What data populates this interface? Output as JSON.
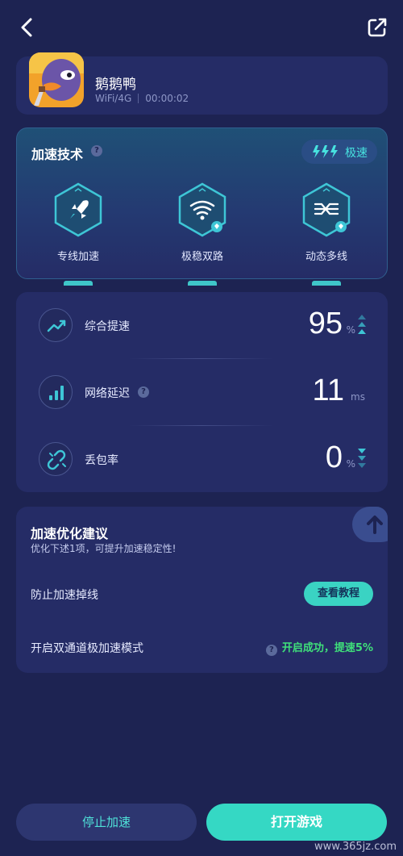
{
  "header": {
    "back_icon": "chevron-left-icon",
    "share_icon": "share-icon"
  },
  "game": {
    "name": "鹅鹅鸭",
    "network": "WiFi/4G",
    "duration": "00:00:02"
  },
  "tech": {
    "title": "加速技术",
    "speed_badge": "极速",
    "items": [
      {
        "label": "专线加速",
        "icon": "rocket-icon"
      },
      {
        "label": "极稳双路",
        "icon": "wifi-icon"
      },
      {
        "label": "动态多线",
        "icon": "multi-line-icon"
      }
    ]
  },
  "stats": [
    {
      "label": "综合提速",
      "value": "95",
      "unit": "%",
      "icon": "trend-up-icon"
    },
    {
      "label": "网络延迟",
      "value": "11",
      "unit": "ms",
      "icon": "bars-icon"
    },
    {
      "label": "丢包率",
      "value": "0",
      "unit": "%",
      "icon": "link-icon"
    }
  ],
  "suggestion": {
    "title": "加速优化建议",
    "subtitle": "优化下述1项，可提升加速稳定性!",
    "rows": [
      {
        "label": "防止加速掉线",
        "action": "查看教程"
      },
      {
        "label": "开启双通道极加速模式",
        "status": "开启成功，提速5%"
      }
    ]
  },
  "buttons": {
    "stop": "停止加速",
    "play": "打开游戏"
  },
  "watermark": "www.365jz.com",
  "colors": {
    "accent": "#35d8c4",
    "success": "#3fe07a",
    "background": "#1d2352",
    "card": "#252c66"
  }
}
